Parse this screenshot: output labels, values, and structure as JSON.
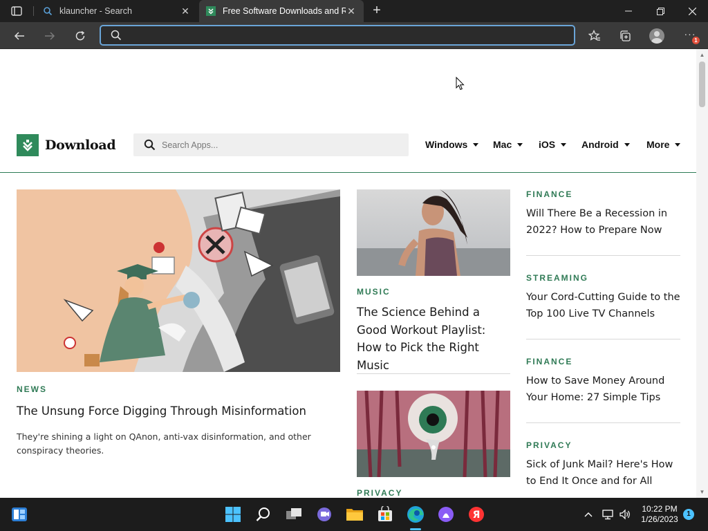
{
  "browser": {
    "tabs": [
      {
        "title": "klauncher - Search",
        "active": false
      },
      {
        "title": "Free Software Downloads and Re",
        "active": true
      }
    ],
    "address_value": "",
    "address_placeholder": "",
    "notification_count": "1"
  },
  "site": {
    "logo_text": "Download",
    "search_placeholder": "Search Apps...",
    "nav": [
      "Windows",
      "Mac",
      "iOS",
      "Android",
      "More"
    ],
    "accent_color": "#2f8a5b"
  },
  "feature": {
    "kicker": "NEWS",
    "headline": "The Unsung Force Digging Through Misinformation",
    "description": "They're shining a light on QAnon, anti-vax disinformation, and other conspiracy theories."
  },
  "middle": [
    {
      "kicker": "MUSIC",
      "headline": "The Science Behind a Good Workout Playlist: How to Pick the Right Music"
    },
    {
      "kicker": "PRIVACY",
      "headline": ""
    }
  ],
  "sidebar": [
    {
      "kicker": "FINANCE",
      "headline": "Will There Be a Recession in 2022? How to Prepare Now"
    },
    {
      "kicker": "STREAMING",
      "headline": "Your Cord-Cutting Guide to the Top 100 Live TV Channels"
    },
    {
      "kicker": "FINANCE",
      "headline": "How to Save Money Around Your Home: 27 Simple Tips"
    },
    {
      "kicker": "PRIVACY",
      "headline": "Sick of Junk Mail? Here's How to End It Once and for All"
    }
  ],
  "taskbar": {
    "time": "10:22 PM",
    "date": "1/26/2023",
    "notification_count": "1",
    "apps": [
      "start",
      "search",
      "task-view",
      "chat",
      "file-explorer",
      "store",
      "edge",
      "alice",
      "yandex"
    ]
  }
}
